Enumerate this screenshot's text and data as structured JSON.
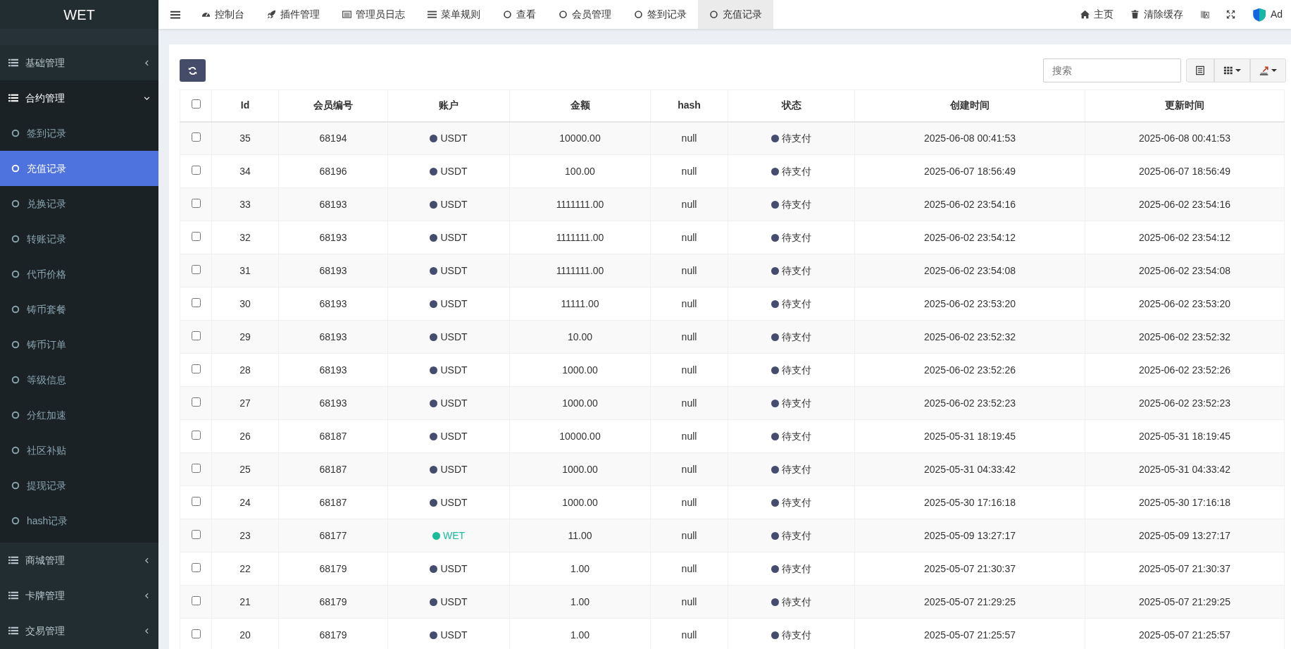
{
  "sidebar": {
    "logo": "WET",
    "items": [
      {
        "label": "基础管理",
        "expanded": false
      },
      {
        "label": "合约管理",
        "expanded": true,
        "children": [
          {
            "label": "签到记录",
            "selected": false
          },
          {
            "label": "充值记录",
            "selected": true
          },
          {
            "label": "兑换记录",
            "selected": false
          },
          {
            "label": "转账记录",
            "selected": false
          },
          {
            "label": "代币价格",
            "selected": false
          },
          {
            "label": "铸币套餐",
            "selected": false
          },
          {
            "label": "铸币订单",
            "selected": false
          },
          {
            "label": "等级信息",
            "selected": false
          },
          {
            "label": "分红加速",
            "selected": false
          },
          {
            "label": "社区补贴",
            "selected": false
          },
          {
            "label": "提现记录",
            "selected": false
          },
          {
            "label": "hash记录",
            "selected": false
          }
        ]
      },
      {
        "label": "商城管理",
        "expanded": false
      },
      {
        "label": "卡牌管理",
        "expanded": false
      },
      {
        "label": "交易管理",
        "expanded": false
      }
    ]
  },
  "tabs": [
    {
      "label": "控制台",
      "kind": "dashboard",
      "selected": false
    },
    {
      "label": "插件管理",
      "kind": "rocket",
      "selected": false
    },
    {
      "label": "管理员日志",
      "kind": "log",
      "selected": false
    },
    {
      "label": "菜单规则",
      "kind": "bars",
      "selected": false
    },
    {
      "label": "查看",
      "kind": "circle",
      "selected": false
    },
    {
      "label": "会员管理",
      "kind": "circle",
      "selected": false
    },
    {
      "label": "签到记录",
      "kind": "circle",
      "selected": false
    },
    {
      "label": "充值记录",
      "kind": "circle",
      "selected": true
    }
  ],
  "top_right": [
    {
      "label": "主页",
      "kind": "home"
    },
    {
      "label": "清除缓存",
      "kind": "trash"
    },
    {
      "kind": "translate"
    },
    {
      "kind": "fullscreen"
    },
    {
      "label": "Ad",
      "kind": "user"
    }
  ],
  "search": {
    "placeholder": "搜索"
  },
  "table": {
    "header_checked": false,
    "columns": [
      "Id",
      "会员编号",
      "账户",
      "金额",
      "hash",
      "状态",
      "创建时间",
      "更新时间"
    ],
    "rows": [
      {
        "checked": false,
        "cells": [
          "35",
          "68194",
          {
            "text": "USDT",
            "color": "#444d6e"
          },
          "10000.00",
          "null",
          {
            "text": "待支付",
            "color": "#444d6e"
          },
          "2025-06-08 00:41:53",
          "2025-06-08 00:41:53"
        ]
      },
      {
        "checked": false,
        "cells": [
          "34",
          "68196",
          {
            "text": "USDT",
            "color": "#444d6e"
          },
          "100.00",
          "null",
          {
            "text": "待支付",
            "color": "#444d6e"
          },
          "2025-06-07 18:56:49",
          "2025-06-07 18:56:49"
        ]
      },
      {
        "checked": false,
        "cells": [
          "33",
          "68193",
          {
            "text": "USDT",
            "color": "#444d6e"
          },
          "1111111.00",
          "null",
          {
            "text": "待支付",
            "color": "#444d6e"
          },
          "2025-06-02 23:54:16",
          "2025-06-02 23:54:16"
        ]
      },
      {
        "checked": false,
        "cells": [
          "32",
          "68193",
          {
            "text": "USDT",
            "color": "#444d6e"
          },
          "1111111.00",
          "null",
          {
            "text": "待支付",
            "color": "#444d6e"
          },
          "2025-06-02 23:54:12",
          "2025-06-02 23:54:12"
        ]
      },
      {
        "checked": false,
        "cells": [
          "31",
          "68193",
          {
            "text": "USDT",
            "color": "#444d6e"
          },
          "1111111.00",
          "null",
          {
            "text": "待支付",
            "color": "#444d6e"
          },
          "2025-06-02 23:54:08",
          "2025-06-02 23:54:08"
        ]
      },
      {
        "checked": false,
        "cells": [
          "30",
          "68193",
          {
            "text": "USDT",
            "color": "#444d6e"
          },
          "11111.00",
          "null",
          {
            "text": "待支付",
            "color": "#444d6e"
          },
          "2025-06-02 23:53:20",
          "2025-06-02 23:53:20"
        ]
      },
      {
        "checked": false,
        "cells": [
          "29",
          "68193",
          {
            "text": "USDT",
            "color": "#444d6e"
          },
          "10.00",
          "null",
          {
            "text": "待支付",
            "color": "#444d6e"
          },
          "2025-06-02 23:52:32",
          "2025-06-02 23:52:32"
        ]
      },
      {
        "checked": false,
        "cells": [
          "28",
          "68193",
          {
            "text": "USDT",
            "color": "#444d6e"
          },
          "1000.00",
          "null",
          {
            "text": "待支付",
            "color": "#444d6e"
          },
          "2025-06-02 23:52:26",
          "2025-06-02 23:52:26"
        ]
      },
      {
        "checked": false,
        "cells": [
          "27",
          "68193",
          {
            "text": "USDT",
            "color": "#444d6e"
          },
          "1000.00",
          "null",
          {
            "text": "待支付",
            "color": "#444d6e"
          },
          "2025-06-02 23:52:23",
          "2025-06-02 23:52:23"
        ]
      },
      {
        "checked": false,
        "cells": [
          "26",
          "68187",
          {
            "text": "USDT",
            "color": "#444d6e"
          },
          "10000.00",
          "null",
          {
            "text": "待支付",
            "color": "#444d6e"
          },
          "2025-05-31 18:19:45",
          "2025-05-31 18:19:45"
        ]
      },
      {
        "checked": false,
        "cells": [
          "25",
          "68187",
          {
            "text": "USDT",
            "color": "#444d6e"
          },
          "1000.00",
          "null",
          {
            "text": "待支付",
            "color": "#444d6e"
          },
          "2025-05-31 04:33:42",
          "2025-05-31 04:33:42"
        ]
      },
      {
        "checked": false,
        "cells": [
          "24",
          "68187",
          {
            "text": "USDT",
            "color": "#444d6e"
          },
          "1000.00",
          "null",
          {
            "text": "待支付",
            "color": "#444d6e"
          },
          "2025-05-30 17:16:18",
          "2025-05-30 17:16:18"
        ]
      },
      {
        "checked": false,
        "cells": [
          "23",
          "68177",
          {
            "text": "WET",
            "color": "#18bc9c",
            "tinted": true
          },
          "11.00",
          "null",
          {
            "text": "待支付",
            "color": "#444d6e"
          },
          "2025-05-09 13:27:17",
          "2025-05-09 13:27:17"
        ]
      },
      {
        "checked": false,
        "cells": [
          "22",
          "68179",
          {
            "text": "USDT",
            "color": "#444d6e"
          },
          "1.00",
          "null",
          {
            "text": "待支付",
            "color": "#444d6e"
          },
          "2025-05-07 21:30:37",
          "2025-05-07 21:30:37"
        ]
      },
      {
        "checked": false,
        "cells": [
          "21",
          "68179",
          {
            "text": "USDT",
            "color": "#444d6e"
          },
          "1.00",
          "null",
          {
            "text": "待支付",
            "color": "#444d6e"
          },
          "2025-05-07 21:29:25",
          "2025-05-07 21:29:25"
        ]
      },
      {
        "checked": false,
        "cells": [
          "20",
          "68179",
          {
            "text": "USDT",
            "color": "#444d6e"
          },
          "1.00",
          "null",
          {
            "text": "待支付",
            "color": "#444d6e"
          },
          "2025-05-07 21:25:57",
          "2025-05-07 21:25:57"
        ]
      }
    ]
  }
}
